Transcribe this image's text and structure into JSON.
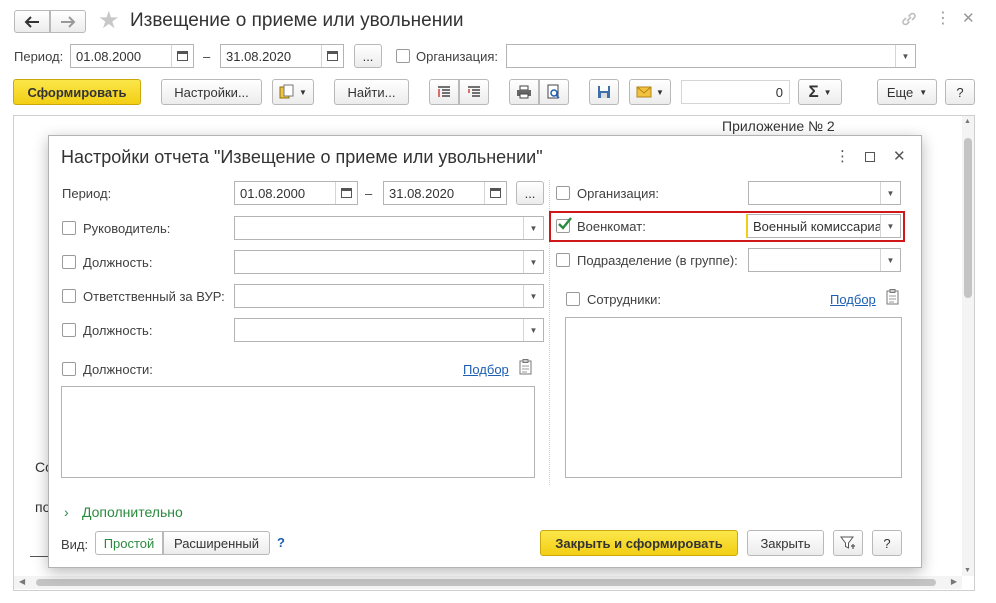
{
  "window": {
    "title": "Извещение о приеме или увольнении",
    "period_label": "Период:",
    "date_from": "01.08.2000",
    "dash": "–",
    "date_to": "31.08.2020",
    "more_btn": "...",
    "org_label": "Организация:",
    "org_value": ""
  },
  "toolbar": {
    "generate": "Сформировать",
    "settings": "Настройки...",
    "find": "Найти...",
    "number_value": "0",
    "more": "Еще",
    "help": "?"
  },
  "report": {
    "appendix": "Приложение № 2",
    "left_text_1": "Со",
    "left_text_2": "по"
  },
  "dialog": {
    "title": "Настройки отчета \"Извещение о приеме или увольнении\"",
    "period_label": "Период:",
    "date_from": "01.08.2000",
    "dash": "–",
    "date_to": "31.08.2020",
    "more_btn": "...",
    "org_label": "Организация:",
    "org_value": "",
    "military_label": "Военкомат:",
    "military_value": "Военный комиссариа",
    "subdivision_label": "Подразделение (в группе):",
    "subdivision_value": "",
    "employees_label": "Сотрудники:",
    "employees_pick": "Подбор",
    "head_label": "Руководитель:",
    "position_label": "Должность:",
    "vur_label": "Ответственный за ВУР:",
    "position2_label": "Должность:",
    "positions_label": "Должности:",
    "positions_pick": "Подбор",
    "additional": "Дополнительно",
    "view_label": "Вид:",
    "view_simple": "Простой",
    "view_extended": "Расширенный",
    "view_help": "?",
    "close_generate": "Закрыть и сформировать",
    "close": "Закрыть",
    "help": "?"
  },
  "colors": {
    "accent_yellow": "#f3cf14",
    "highlight_red": "#d01818",
    "check_green": "#2a8a3e",
    "link_blue": "#1c5fb3"
  }
}
